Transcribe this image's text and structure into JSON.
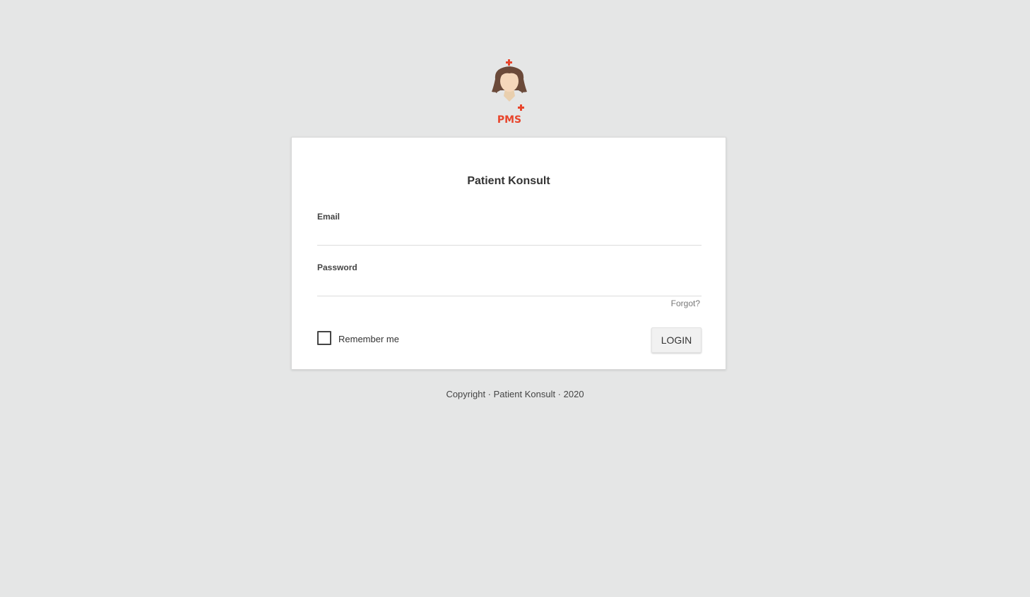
{
  "logo": {
    "text": "PMS",
    "icon": "nurse-icon",
    "accent_color": "#e8452c"
  },
  "card": {
    "title": "Patient Konsult"
  },
  "form": {
    "email_label": "Email",
    "email_value": "",
    "password_label": "Password",
    "password_value": "",
    "forgot_label": "Forgot?",
    "remember_label": "Remember me",
    "remember_checked": false,
    "login_label": "LOGIN"
  },
  "footer": {
    "text": "Copyright · Patient Konsult · 2020"
  },
  "colors": {
    "background": "#e5e6e6",
    "card": "#ffffff"
  }
}
